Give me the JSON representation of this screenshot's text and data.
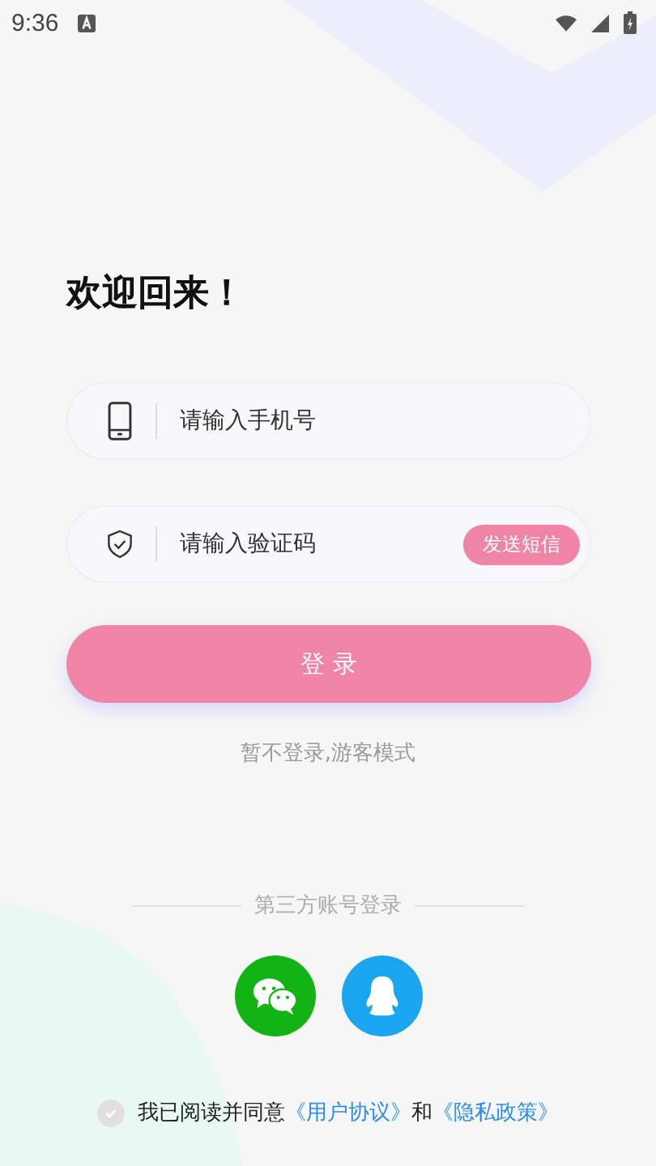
{
  "status_bar": {
    "time": "9:36"
  },
  "title": "欢迎回来！",
  "phone_field": {
    "placeholder": "请输入手机号"
  },
  "code_field": {
    "placeholder": "请输入验证码",
    "send_button": "发送短信"
  },
  "login_button": "登 录",
  "guest_link": "暂不登录,游客模式",
  "third_party": {
    "label": "第三方账号登录",
    "providers": [
      {
        "kind": "wechat"
      },
      {
        "kind": "qq"
      }
    ]
  },
  "agreement": {
    "checked": false,
    "text": "我已阅读并同意",
    "links": [
      "《用户协议》",
      "《隐私政策》"
    ],
    "conjunction": "和"
  }
}
